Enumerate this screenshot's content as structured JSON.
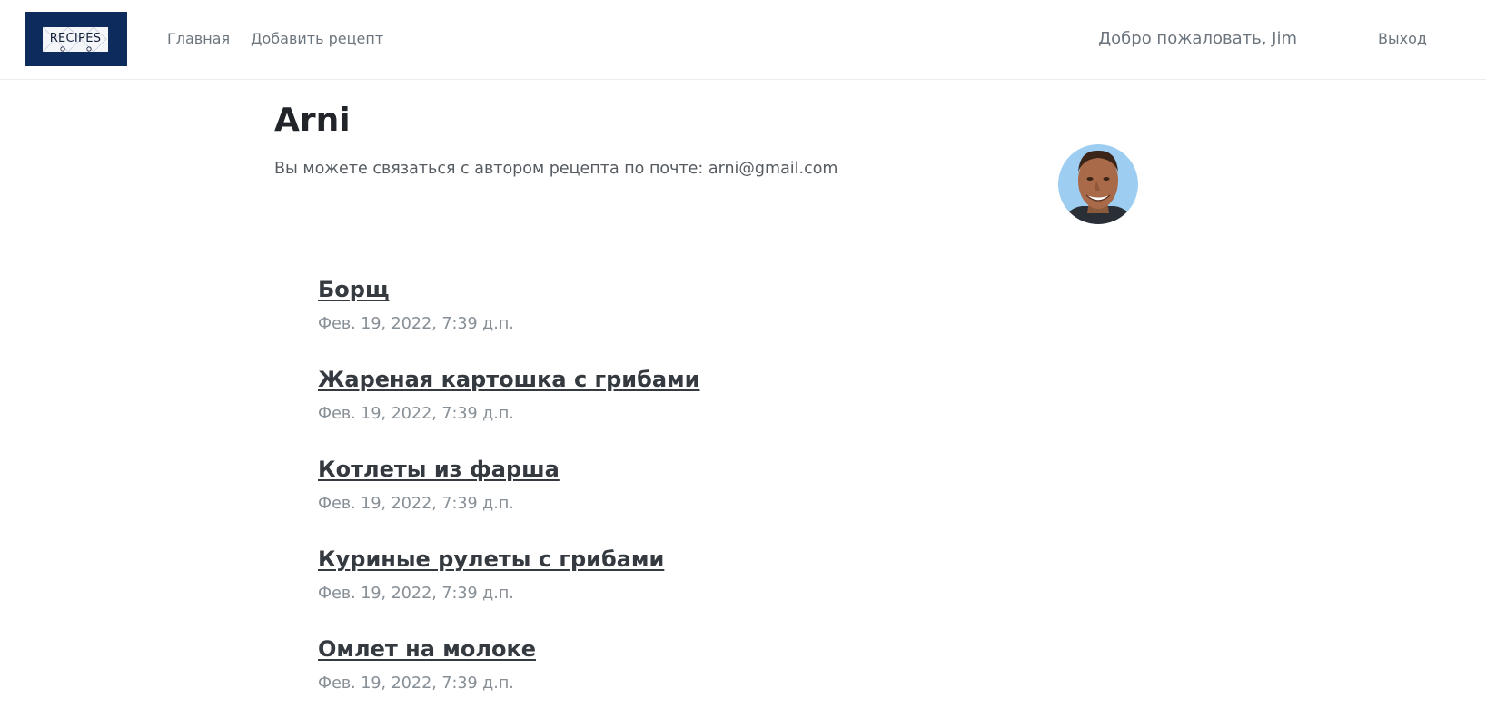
{
  "navbar": {
    "logo_text": "RECIPES",
    "links": [
      "Главная",
      "Добавить рецепт"
    ],
    "welcome": "Добро пожаловать, Jim",
    "logout": "Выход"
  },
  "author": {
    "name": "Arni",
    "contact": "Вы можете связаться с автором рецепта по почте: arni@gmail.com"
  },
  "recipes": [
    {
      "title": "Борщ",
      "date": "Фев. 19, 2022, 7:39 д.п."
    },
    {
      "title": "Жареная картошка с грибами",
      "date": "Фев. 19, 2022, 7:39 д.п."
    },
    {
      "title": "Котлеты из фарша",
      "date": "Фев. 19, 2022, 7:39 д.п."
    },
    {
      "title": "Куриные рулеты с грибами",
      "date": "Фев. 19, 2022, 7:39 д.п."
    },
    {
      "title": "Омлет на молоке",
      "date": "Фев. 19, 2022, 7:39 д.п."
    }
  ],
  "colors": {
    "logo_bg": "#0d2b5c",
    "text_dark": "#212529",
    "text_muted": "#6c757d",
    "date_gray": "#868e96",
    "avatar_bg": "#9ecdf2"
  }
}
